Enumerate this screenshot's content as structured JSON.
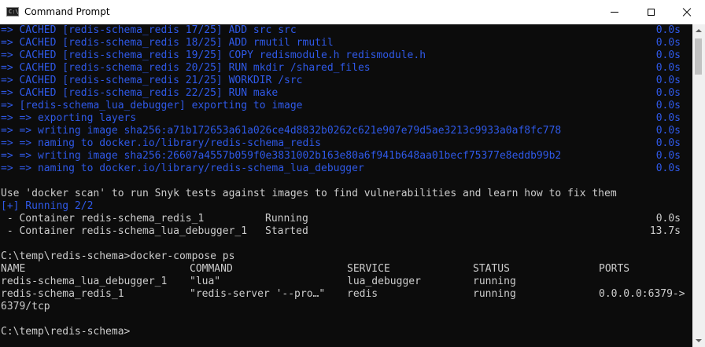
{
  "window": {
    "title": "Command Prompt",
    "icon": "cmd-icon",
    "icon_glyph": "C:\\"
  },
  "colors": {
    "background": "#0c0c0c",
    "build_text": "#2f59e8",
    "normal_text": "#cccccc"
  },
  "build_lines": [
    {
      "text": "=> CACHED [redis-schema_redis 17/25] ADD src src",
      "time": "0.0s"
    },
    {
      "text": "=> CACHED [redis-schema_redis 18/25] ADD rmutil rmutil",
      "time": "0.0s"
    },
    {
      "text": "=> CACHED [redis-schema_redis 19/25] COPY redismodule.h redismodule.h",
      "time": "0.0s"
    },
    {
      "text": "=> CACHED [redis-schema_redis 20/25] RUN mkdir /shared_files",
      "time": "0.0s"
    },
    {
      "text": "=> CACHED [redis-schema_redis 21/25] WORKDIR /src",
      "time": "0.0s"
    },
    {
      "text": "=> CACHED [redis-schema_redis 22/25] RUN make",
      "time": "0.0s"
    },
    {
      "text": "=> [redis-schema_lua_debugger] exporting to image",
      "time": "0.0s"
    },
    {
      "text": "=> => exporting layers",
      "time": "0.0s"
    },
    {
      "text": "=> => writing image sha256:a71b172653a61a026ce4d8832b0262c621e907e79d5ae3213c9933a0af8fc778",
      "time": "0.0s"
    },
    {
      "text": "=> => naming to docker.io/library/redis-schema_redis",
      "time": "0.0s"
    },
    {
      "text": "=> => writing image sha256:26607a4557b059f0e3831002b163e80a6f941b648aa01becf75377e8eddb99b2",
      "time": "0.0s"
    },
    {
      "text": "=> => naming to docker.io/library/redis-schema_lua_debugger",
      "time": "0.0s"
    }
  ],
  "scan_message": "Use 'docker scan' to run Snyk tests against images to find vulnerabilities and learn how to fix them",
  "running_status": "[+] Running 2/2",
  "containers": [
    {
      "name": " - Container redis-schema_redis_1",
      "state": "Running",
      "time": "0.0s"
    },
    {
      "name": " - Container redis-schema_lua_debugger_1",
      "state": "Started",
      "time": "13.7s"
    }
  ],
  "prompt_command": "C:\\temp\\redis-schema>docker-compose ps",
  "ps_table": {
    "headers": [
      "NAME",
      "COMMAND",
      "SERVICE",
      "STATUS",
      "PORTS"
    ],
    "rows": [
      [
        "redis-schema_lua_debugger_1",
        "\"lua\"",
        "lua_debugger",
        "running",
        ""
      ],
      [
        "redis-schema_redis_1",
        "\"redis-server '--pro…\"",
        "redis",
        "running",
        "0.0.0.0:6379->"
      ]
    ],
    "wrap_line": "6379/tcp"
  },
  "final_prompt": "C:\\temp\\redis-schema>"
}
